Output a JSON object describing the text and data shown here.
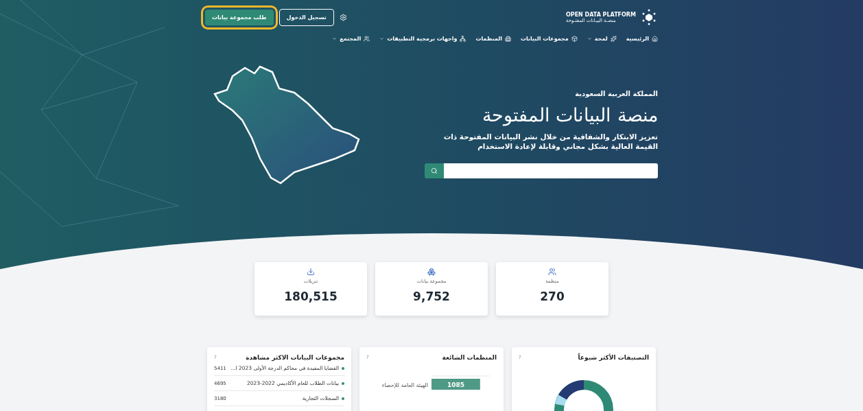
{
  "header": {
    "logo": {
      "title": "OPEN DATA PLATFORM",
      "subtitle": "منصـة البيـانات المفتـوحة"
    },
    "buttons": [
      {
        "label": "تسجيل الدخول",
        "kind": "outline"
      },
      {
        "label": "طلب مجموعة بيانات",
        "kind": "primary"
      }
    ]
  },
  "nav": [
    {
      "label": "الرئيسية",
      "dropdown": false
    },
    {
      "label": "لمحة",
      "dropdown": true
    },
    {
      "label": "مجموعات البيانات",
      "dropdown": false
    },
    {
      "label": "المنظمات",
      "dropdown": false
    },
    {
      "label": "واجهات برمجية التطبيقات",
      "dropdown": true
    },
    {
      "label": "المجتمع",
      "dropdown": true
    }
  ],
  "hero": {
    "eyebrow": "المملكة العربية السعودية",
    "title": "منصة البيانات المفتوحة",
    "description": "تعزيز الابتكار والشفافية من خلال نشر البيانات المفتوحة ذات القيمة العالية بشكل مجاني وقابلة لإعادة الاستخدام"
  },
  "stats": [
    {
      "label": "منظمة",
      "value": "270"
    },
    {
      "label": "مجموعة بيانات",
      "value": "9,752"
    },
    {
      "label": "تنزيلات",
      "value": "180,515"
    }
  ],
  "panels": [
    {
      "kind": "donut",
      "title": "التصنيفات الأكثر شيوعاً",
      "help": "?"
    },
    {
      "kind": "bar",
      "title": "المنظمات الشائعة",
      "help": "?",
      "chart_data": {
        "type": "bar",
        "orientation": "horizontal",
        "categories": [
          "الهيئة العامة للإحصاء"
        ],
        "values": [
          1085
        ],
        "data_labels": true
      }
    },
    {
      "kind": "list",
      "title": "مجموعات البيانات الاكثر مشاهدة",
      "help": "?",
      "rows": [
        {
          "title": "القضايا المفيدة في محاكم الدرجة الأولى 2023 ا...",
          "count": "5411"
        },
        {
          "title": "بيانات الطلاب للعام الأكاديمي 2022-2023",
          "count": "4695"
        },
        {
          "title": "السجلات التجارية",
          "count": "3180"
        }
      ]
    }
  ]
}
